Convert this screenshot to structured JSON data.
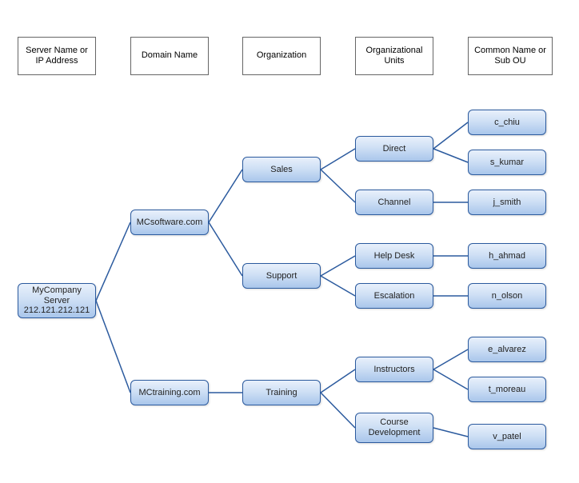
{
  "headers": {
    "server": "Server Name or IP Address",
    "domain": "Domain Name",
    "organization": "Organization",
    "ou": "Organizational Units",
    "cn": "Common Name or Sub OU"
  },
  "server": {
    "label": "MyCompany Server 212.121.212.121"
  },
  "domains": {
    "software": "MCsoftware.com",
    "training": "MCtraining.com"
  },
  "organizations": {
    "sales": "Sales",
    "support": "Support",
    "training": "Training"
  },
  "ous": {
    "direct": "Direct",
    "channel": "Channel",
    "helpdesk": "Help Desk",
    "escalation": "Escalation",
    "instructors": "Instructors",
    "coursedev": "Course Development"
  },
  "cns": {
    "c_chiu": "c_chiu",
    "s_kumar": "s_kumar",
    "j_smith": "j_smith",
    "h_ahmad": "h_ahmad",
    "n_olson": "n_olson",
    "e_alvarez": "e_alvarez",
    "t_moreau": "t_moreau",
    "v_patel": "v_patel"
  }
}
